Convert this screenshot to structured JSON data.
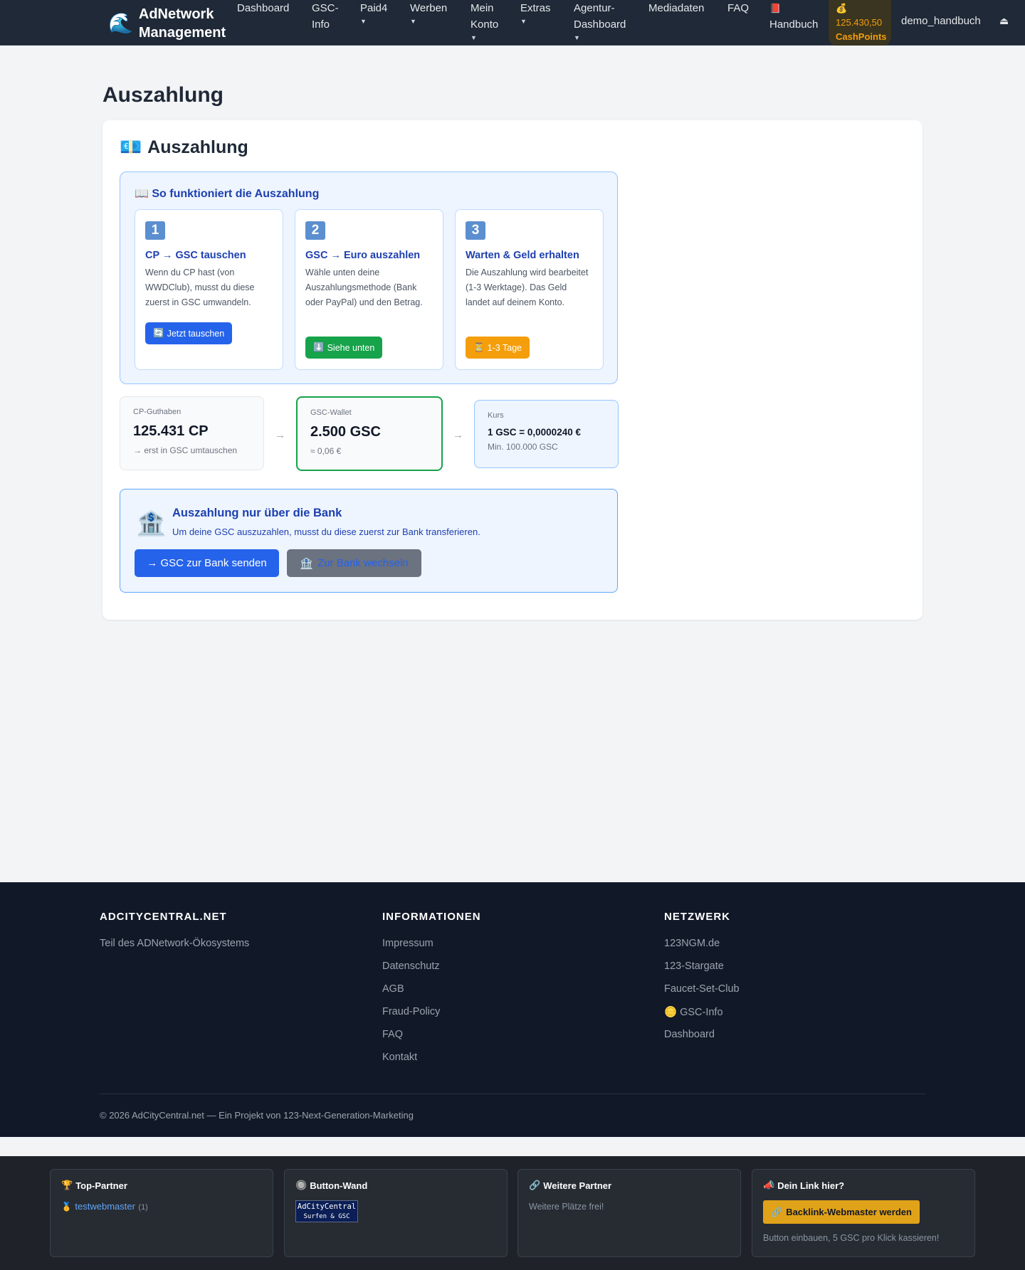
{
  "nav": {
    "brand_icon": "🌊",
    "brand_line1": "AdNetwork",
    "brand_line2": "Management",
    "items": {
      "dashboard": "Dashboard",
      "gsc_info_1": "GSC-",
      "gsc_info_2": "Info",
      "paid4": "Paid4",
      "werben": "Werben",
      "mein_konto_1": "Mein",
      "mein_konto_2": "Konto",
      "extras": "Extras",
      "agentur_1": "Agentur-",
      "agentur_2": "Dashboard",
      "mediadaten": "Mediadaten",
      "faq": "FAQ",
      "handbuch_icon": "📕",
      "handbuch": "Handbuch"
    },
    "caret": "▼",
    "cashpoints_icon": "💰",
    "cashpoints_value": "125.430,50",
    "cashpoints_label": "CashPoints",
    "username": "demo_handbuch",
    "logout_icon": "⏏"
  },
  "main": {
    "page_title": "Auszahlung",
    "card_icon": "💶",
    "card_title": "Auszahlung",
    "howto": {
      "icon": "📖",
      "title": "So funktioniert die Auszahlung",
      "steps": [
        {
          "num": "1",
          "title": "CP → GSC tauschen",
          "text": "Wenn du CP hast (von WWDClub), musst du diese zuerst in GSC umwandeln.",
          "button_icon": "🔄",
          "button": "Jetzt tauschen",
          "button_color": "#2563eb"
        },
        {
          "num": "2",
          "title": "GSC → Euro auszahlen",
          "text": "Wähle unten deine Auszahlungsmethode (Bank oder PayPal) und den Betrag.",
          "button_icon": "⬇️",
          "button": "Siehe unten",
          "button_color": "#16a34a"
        },
        {
          "num": "3",
          "title": "Warten & Geld erhalten",
          "text": "Die Auszahlung wird bearbeitet (1-3 Werktage). Das Geld landet auf deinem Konto.",
          "button_icon": "⏳",
          "button": "1-3 Tage",
          "button_color": "#f59e0b"
        }
      ]
    },
    "stats": {
      "cp": {
        "label": "CP-Guthaben",
        "value": "125.431 CP",
        "sub": "→ erst in GSC umtauschen"
      },
      "gsc": {
        "label": "GSC-Wallet",
        "value": "2.500 GSC",
        "sub": "≈ 0,06 €"
      },
      "kurs": {
        "label": "Kurs",
        "value": "1 GSC = 0,0000240 €",
        "sub": "Min. 100.000 GSC"
      },
      "arrow": "→"
    },
    "bank": {
      "icon": "🏦",
      "title": "Auszahlung nur über die Bank",
      "text": "Um deine GSC auszuzahlen, musst du diese zuerst zur Bank transferieren.",
      "send_button": "→ GSC zur Bank senden",
      "switch_icon": "🏦",
      "switch_button": "Zur Bank wechseln"
    }
  },
  "footer": {
    "col1": {
      "title": "ADCITYCENTRAL.NET",
      "text": "Teil des ADNetwork-Ökosystems"
    },
    "col2": {
      "title": "INFORMATIONEN",
      "links": [
        "Impressum",
        "Datenschutz",
        "AGB",
        "Fraud-Policy",
        "FAQ",
        "Kontakt"
      ]
    },
    "col3": {
      "title": "NETZWERK",
      "links": [
        "123NGM.de",
        "123-Stargate",
        "Faucet-Set-Club",
        "GSC-Info",
        "Dashboard"
      ],
      "gsc_icon": "🪙"
    },
    "copyright": "© 2026 AdCityCentral.net — Ein Projekt von 123-Next-Generation-Marketing"
  },
  "partners": {
    "top": {
      "icon": "🏆",
      "title": "Top-Partner",
      "medal": "🥇",
      "link": "testwebmaster",
      "count": "(1)"
    },
    "wall": {
      "icon": "🔘",
      "title": "Button-Wand",
      "btn_line1": "AdCityCentral",
      "btn_line2": "Surfen & GSC"
    },
    "more": {
      "icon": "🔗",
      "title": "Weitere Partner",
      "text": "Weitere Plätze frei!"
    },
    "yours": {
      "icon": "📣",
      "title": "Dein Link hier?",
      "button_icon": "🔗",
      "button": "Backlink-Webmaster werden",
      "text": "Button einbauen, 5 GSC pro Klick kassieren!"
    }
  }
}
